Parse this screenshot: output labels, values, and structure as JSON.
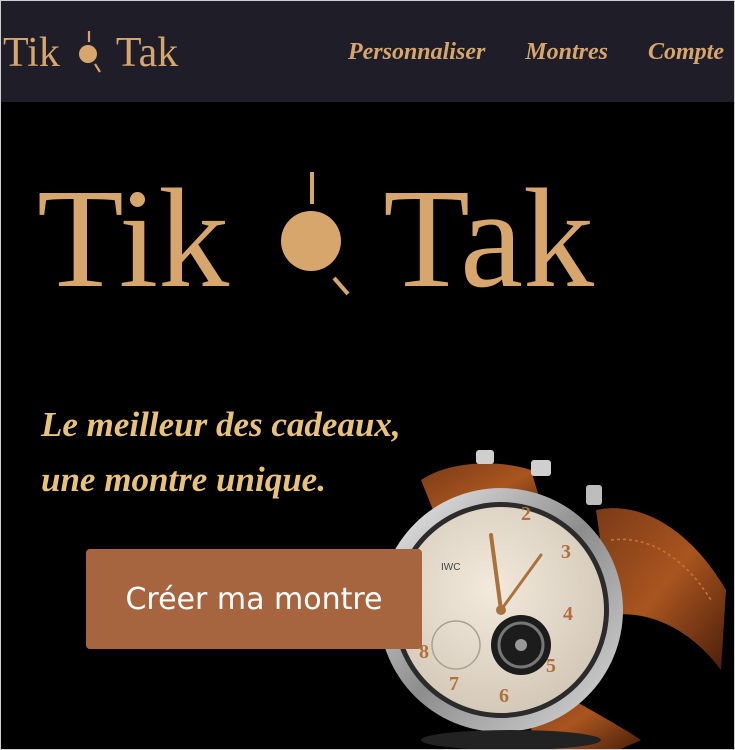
{
  "colors": {
    "brand_gold": "#d6a66c",
    "tagline_gold": "#e8c27a",
    "nav_background": "#1f1d27",
    "hero_background": "#000000",
    "cta_background": "#a6653e",
    "cta_text": "#ffffff"
  },
  "nav": {
    "logo": {
      "part1": "Tik",
      "part2": "Tak",
      "mark_icon": "clock-dot-icon"
    },
    "links": [
      {
        "label": "Personnaliser"
      },
      {
        "label": "Montres"
      },
      {
        "label": "Compte"
      }
    ]
  },
  "hero": {
    "logo": {
      "part1": "Tik",
      "part2": "Tak",
      "mark_icon": "clock-dot-icon"
    },
    "tagline_line1": "Le meilleur des cadeaux,",
    "tagline_line2": "une montre unique.",
    "cta_label": "Créer ma montre",
    "image": "wristwatch-photo"
  }
}
